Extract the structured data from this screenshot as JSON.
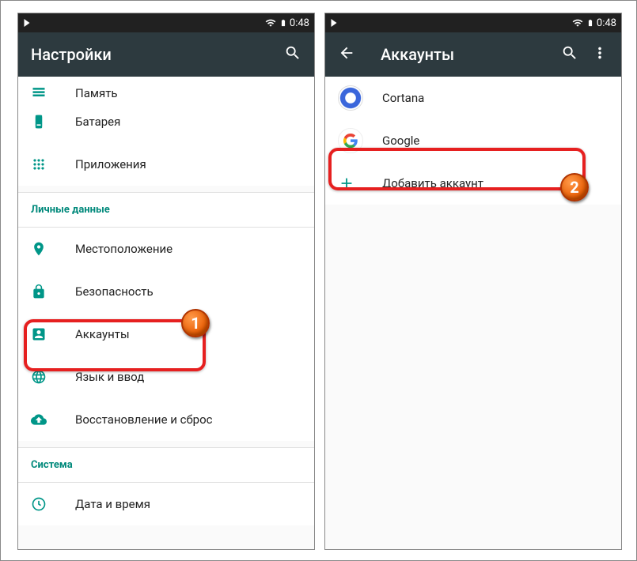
{
  "status": {
    "time": "0:48"
  },
  "left": {
    "title": "Настройки",
    "items": {
      "memory": "Память",
      "battery": "Батарея",
      "apps": "Приложения",
      "location": "Местоположение",
      "security": "Безопасность",
      "accounts": "Аккаунты",
      "language": "Язык и ввод",
      "backup": "Восстановление и сброс",
      "datetime": "Дата и время"
    },
    "sections": {
      "personal": "Личные данные",
      "system": "Система"
    }
  },
  "right": {
    "title": "Аккаунты",
    "items": {
      "cortana": "Cortana",
      "google": "Google",
      "add": "Добавить аккаунт"
    }
  },
  "markers": {
    "one": "1",
    "two": "2"
  }
}
